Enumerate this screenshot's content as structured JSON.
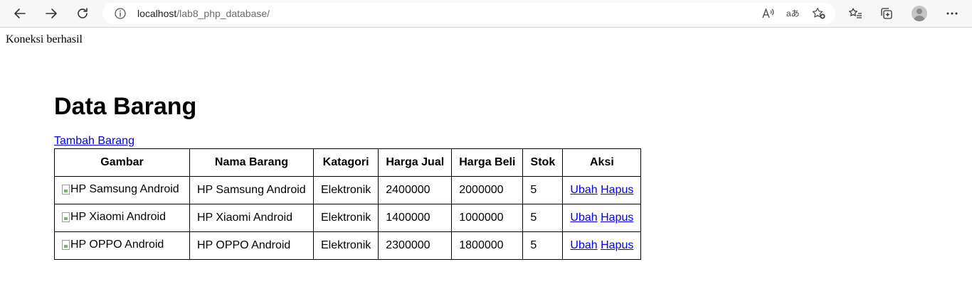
{
  "browser": {
    "url_host": "localhost",
    "url_path": "/lab8_php_database/"
  },
  "page": {
    "status": "Koneksi berhasil",
    "title": "Data Barang",
    "add_link": "Tambah Barang"
  },
  "table": {
    "headers": [
      "Gambar",
      "Nama Barang",
      "Katagori",
      "Harga Jual",
      "Harga Beli",
      "Stok",
      "Aksi"
    ],
    "rows": [
      {
        "gambar_alt": "HP Samsung Android",
        "nama": "HP Samsung Android",
        "kategori": "Elektronik",
        "harga_jual": "2400000",
        "harga_beli": "2000000",
        "stok": "5",
        "ubah": "Ubah",
        "hapus": "Hapus"
      },
      {
        "gambar_alt": "HP Xiaomi Android",
        "nama": "HP Xiaomi Android",
        "kategori": "Elektronik",
        "harga_jual": "1400000",
        "harga_beli": "1000000",
        "stok": "5",
        "ubah": "Ubah",
        "hapus": "Hapus"
      },
      {
        "gambar_alt": "HP OPPO Android",
        "nama": "HP OPPO Android",
        "kategori": "Elektronik",
        "harga_jual": "2300000",
        "harga_beli": "1800000",
        "stok": "5",
        "ubah": "Ubah",
        "hapus": "Hapus"
      }
    ]
  },
  "colors": {
    "link": "#0000ee",
    "toolbar_bg": "#f7f7f7"
  }
}
